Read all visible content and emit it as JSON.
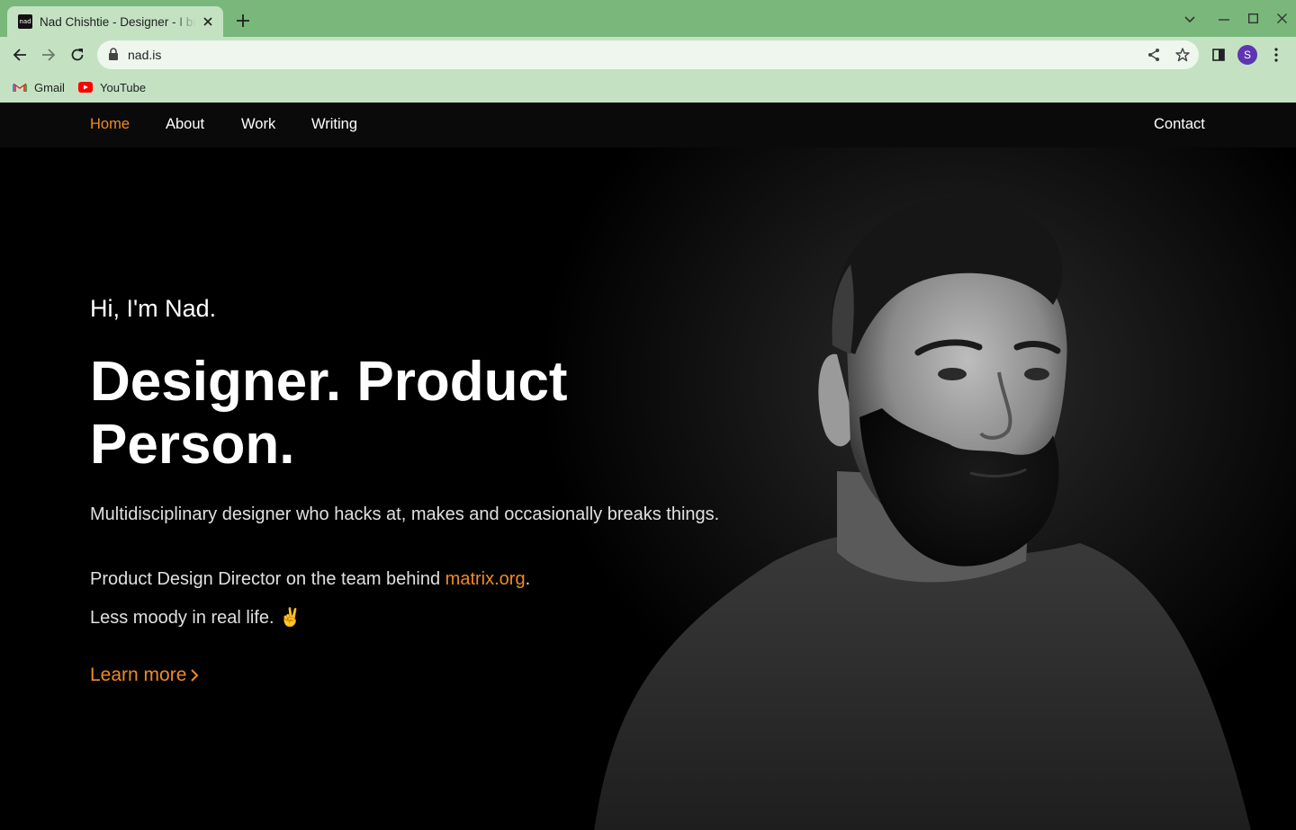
{
  "browser": {
    "tab_title": "Nad Chishtie - Designer - I build things",
    "favicon_text": "nad",
    "url": "nad.is",
    "profile_initial": "S",
    "bookmarks": [
      {
        "label": "Gmail",
        "icon": "gmail-icon"
      },
      {
        "label": "YouTube",
        "icon": "youtube-icon"
      }
    ]
  },
  "nav": {
    "home": "Home",
    "about": "About",
    "work": "Work",
    "writing": "Writing",
    "contact": "Contact"
  },
  "hero": {
    "greeting": "Hi, I'm Nad.",
    "headline": "Designer. Product Person.",
    "p1": "Multidisciplinary designer who hacks at, makes and occasionally breaks things.",
    "p2_prefix": "Product Design Director on the team behind ",
    "p2_link": "matrix.org",
    "p2_suffix": ".",
    "p3": "Less moody in real life. ✌️",
    "learn_more": "Learn more"
  },
  "colors": {
    "accent": "#f08a24",
    "tabstrip": "#79b87a",
    "toolbar": "#c4e2c2",
    "page_bg": "#000000"
  }
}
